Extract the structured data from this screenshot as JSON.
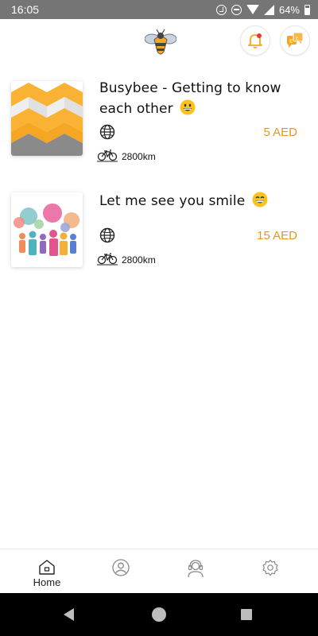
{
  "status_bar": {
    "time": "16:05",
    "battery": "64%"
  },
  "header": {
    "logo_icon": "bee-logo-icon",
    "notification_icon": "bell-icon",
    "language_icon": "language-chat-icon",
    "accent": "#f5a623"
  },
  "activities": [
    {
      "title": "Busybee - Getting to know each other",
      "emoji": "grinning-face-icon",
      "price": "5 AED",
      "distance": "2800km"
    },
    {
      "title": "Let me see you smile",
      "emoji": "beaming-face-icon",
      "price": "15 AED",
      "distance": "2800km"
    }
  ],
  "bottom_nav": {
    "items": [
      {
        "label": "Home",
        "icon": "home-icon",
        "active": true
      },
      {
        "label": "",
        "icon": "profile-icon",
        "active": false
      },
      {
        "label": "",
        "icon": "support-agent-icon",
        "active": false
      },
      {
        "label": "",
        "icon": "settings-icon",
        "active": false
      }
    ]
  },
  "colors": {
    "price": "#e8961a",
    "status_bar": "#757575"
  }
}
